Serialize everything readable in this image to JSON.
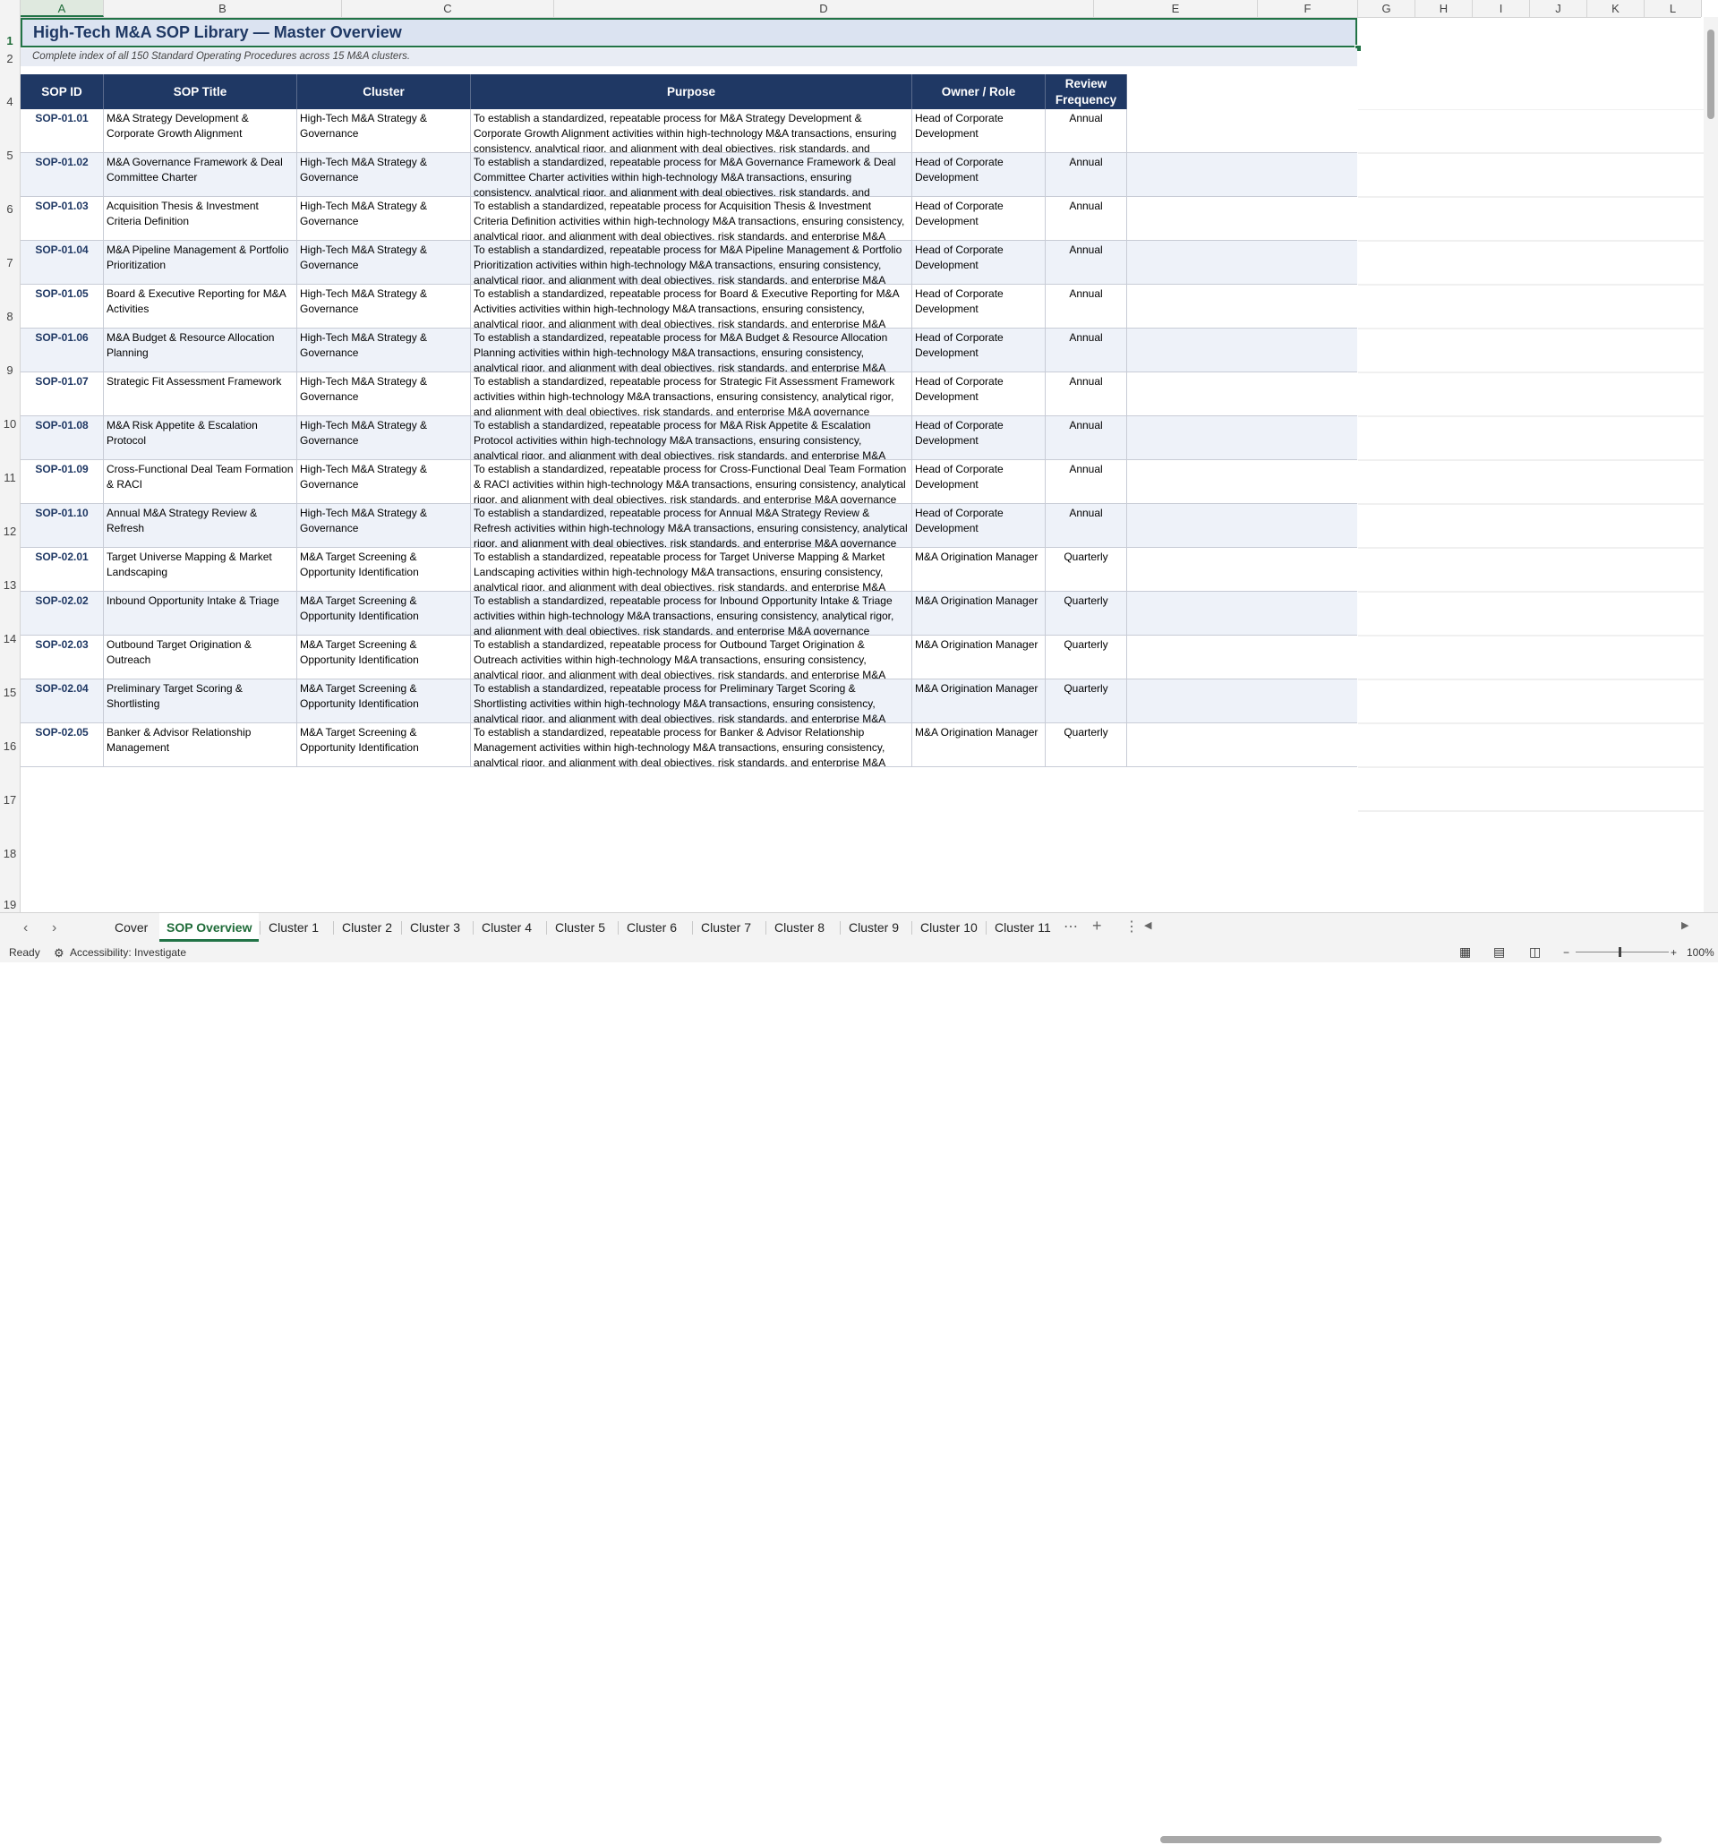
{
  "columns": [
    "A",
    "B",
    "C",
    "D",
    "E",
    "F",
    "G",
    "H",
    "I",
    "J",
    "K",
    "L"
  ],
  "row_numbers": [
    "1",
    "2",
    "4",
    "5",
    "6",
    "7",
    "8",
    "9",
    "10",
    "11",
    "12",
    "13",
    "14",
    "15",
    "16",
    "17",
    "18",
    "19"
  ],
  "title": "High-Tech M&A SOP Library — Master Overview",
  "subtitle": "Complete index of all 150 Standard Operating Procedures across 15 M&A clusters.",
  "headers": [
    "SOP ID",
    "SOP Title",
    "Cluster",
    "Purpose",
    "Owner / Role",
    "Review Frequency"
  ],
  "rows": [
    {
      "id": "SOP-01.01",
      "title": "M&A Strategy Development & Corporate Growth Alignment",
      "cluster": "High-Tech M&A Strategy & Governance",
      "purpose": "To establish a standardized, repeatable process for M&A Strategy Development & Corporate Growth Alignment activities within high-technology M&A transactions, ensuring consistency, analytical rigor, and alignment with deal objectives, risk standards, and enterprise M&A governance requirements.",
      "owner": "Head of Corporate Development",
      "freq": "Annual"
    },
    {
      "id": "SOP-01.02",
      "title": "M&A Governance Framework & Deal Committee Charter",
      "cluster": "High-Tech M&A Strategy & Governance",
      "purpose": "To establish a standardized, repeatable process for M&A Governance Framework & Deal Committee Charter activities within high-technology M&A transactions, ensuring consistency, analytical rigor, and alignment with deal objectives, risk standards, and enterprise M&A governance requirements.",
      "owner": "Head of Corporate Development",
      "freq": "Annual"
    },
    {
      "id": "SOP-01.03",
      "title": "Acquisition Thesis & Investment Criteria Definition",
      "cluster": "High-Tech M&A Strategy & Governance",
      "purpose": "To establish a standardized, repeatable process for Acquisition Thesis & Investment Criteria Definition activities within high-technology M&A transactions, ensuring consistency, analytical rigor, and alignment with deal objectives, risk standards, and enterprise M&A governance requirements.",
      "owner": "Head of Corporate Development",
      "freq": "Annual"
    },
    {
      "id": "SOP-01.04",
      "title": "M&A Pipeline Management & Portfolio Prioritization",
      "cluster": "High-Tech M&A Strategy & Governance",
      "purpose": "To establish a standardized, repeatable process for M&A Pipeline Management & Portfolio Prioritization activities within high-technology M&A transactions, ensuring consistency, analytical rigor, and alignment with deal objectives, risk standards, and enterprise M&A governance requirements.",
      "owner": "Head of Corporate Development",
      "freq": "Annual"
    },
    {
      "id": "SOP-01.05",
      "title": "Board & Executive Reporting for M&A Activities",
      "cluster": "High-Tech M&A Strategy & Governance",
      "purpose": "To establish a standardized, repeatable process for Board & Executive Reporting for M&A Activities activities within high-technology M&A transactions, ensuring consistency, analytical rigor, and alignment with deal objectives, risk standards, and enterprise M&A governance requirements.",
      "owner": "Head of Corporate Development",
      "freq": "Annual"
    },
    {
      "id": "SOP-01.06",
      "title": "M&A Budget & Resource Allocation Planning",
      "cluster": "High-Tech M&A Strategy & Governance",
      "purpose": "To establish a standardized, repeatable process for M&A Budget & Resource Allocation Planning activities within high-technology M&A transactions, ensuring consistency, analytical rigor, and alignment with deal objectives, risk standards, and enterprise M&A governance requirements.",
      "owner": "Head of Corporate Development",
      "freq": "Annual"
    },
    {
      "id": "SOP-01.07",
      "title": "Strategic Fit Assessment Framework",
      "cluster": "High-Tech M&A Strategy & Governance",
      "purpose": "To establish a standardized, repeatable process for Strategic Fit Assessment Framework activities within high-technology M&A transactions, ensuring consistency, analytical rigor, and alignment with deal objectives, risk standards, and enterprise M&A governance requirements.",
      "owner": "Head of Corporate Development",
      "freq": "Annual"
    },
    {
      "id": "SOP-01.08",
      "title": "M&A Risk Appetite & Escalation Protocol",
      "cluster": "High-Tech M&A Strategy & Governance",
      "purpose": "To establish a standardized, repeatable process for M&A Risk Appetite & Escalation Protocol activities within high-technology M&A transactions, ensuring consistency, analytical rigor, and alignment with deal objectives, risk standards, and enterprise M&A governance requirements.",
      "owner": "Head of Corporate Development",
      "freq": "Annual"
    },
    {
      "id": "SOP-01.09",
      "title": "Cross-Functional Deal Team Formation & RACI",
      "cluster": "High-Tech M&A Strategy & Governance",
      "purpose": "To establish a standardized, repeatable process for Cross-Functional Deal Team Formation & RACI activities within high-technology M&A transactions, ensuring consistency, analytical rigor, and alignment with deal objectives, risk standards, and enterprise M&A governance requirements.",
      "owner": "Head of Corporate Development",
      "freq": "Annual"
    },
    {
      "id": "SOP-01.10",
      "title": "Annual M&A Strategy Review & Refresh",
      "cluster": "High-Tech M&A Strategy & Governance",
      "purpose": "To establish a standardized, repeatable process for Annual M&A Strategy Review & Refresh activities within high-technology M&A transactions, ensuring consistency, analytical rigor, and alignment with deal objectives, risk standards, and enterprise M&A governance requirements.",
      "owner": "Head of Corporate Development",
      "freq": "Annual"
    },
    {
      "id": "SOP-02.01",
      "title": "Target Universe Mapping & Market Landscaping",
      "cluster": "M&A Target Screening & Opportunity Identification",
      "purpose": "To establish a standardized, repeatable process for Target Universe Mapping & Market Landscaping activities within high-technology M&A transactions, ensuring consistency, analytical rigor, and alignment with deal objectives, risk standards, and enterprise M&A governance requirements.",
      "owner": "M&A Origination Manager",
      "freq": "Quarterly"
    },
    {
      "id": "SOP-02.02",
      "title": "Inbound Opportunity Intake & Triage",
      "cluster": "M&A Target Screening & Opportunity Identification",
      "purpose": "To establish a standardized, repeatable process for Inbound Opportunity Intake & Triage activities within high-technology M&A transactions, ensuring consistency, analytical rigor, and alignment with deal objectives, risk standards, and enterprise M&A governance requirements.",
      "owner": "M&A Origination Manager",
      "freq": "Quarterly"
    },
    {
      "id": "SOP-02.03",
      "title": "Outbound Target Origination & Outreach",
      "cluster": "M&A Target Screening & Opportunity Identification",
      "purpose": "To establish a standardized, repeatable process for Outbound Target Origination & Outreach activities within high-technology M&A transactions, ensuring consistency, analytical rigor, and alignment with deal objectives, risk standards, and enterprise M&A governance requirements.",
      "owner": "M&A Origination Manager",
      "freq": "Quarterly"
    },
    {
      "id": "SOP-02.04",
      "title": "Preliminary Target Scoring & Shortlisting",
      "cluster": "M&A Target Screening & Opportunity Identification",
      "purpose": "To establish a standardized, repeatable process for Preliminary Target Scoring & Shortlisting activities within high-technology M&A transactions, ensuring consistency, analytical rigor, and alignment with deal objectives, risk standards, and enterprise M&A governance requirements.",
      "owner": "M&A Origination Manager",
      "freq": "Quarterly"
    },
    {
      "id": "SOP-02.05",
      "title": "Banker & Advisor Relationship Management",
      "cluster": "M&A Target Screening & Opportunity Identification",
      "purpose": "To establish a standardized, repeatable process for Banker & Advisor Relationship Management activities within high-technology M&A transactions, ensuring consistency, analytical rigor, and alignment with deal objectives, risk standards, and enterprise M&A governance requirements.",
      "owner": "M&A Origination Manager",
      "freq": "Quarterly"
    }
  ],
  "tabs": [
    "Cover",
    "SOP Overview",
    "Cluster 1",
    "Cluster 2",
    "Cluster 3",
    "Cluster 4",
    "Cluster 5",
    "Cluster 6",
    "Cluster 7",
    "Cluster 8",
    "Cluster 9",
    "Cluster 10",
    "Cluster 11"
  ],
  "active_tab": "SOP Overview",
  "status": {
    "ready": "Ready",
    "accessibility": "Accessibility: Investigate",
    "zoom": "100%"
  },
  "colors": {
    "header_bg": "#1f3864",
    "title_bg": "#dbe3f1",
    "accent": "#217346",
    "alt_row": "#eef2f9"
  }
}
